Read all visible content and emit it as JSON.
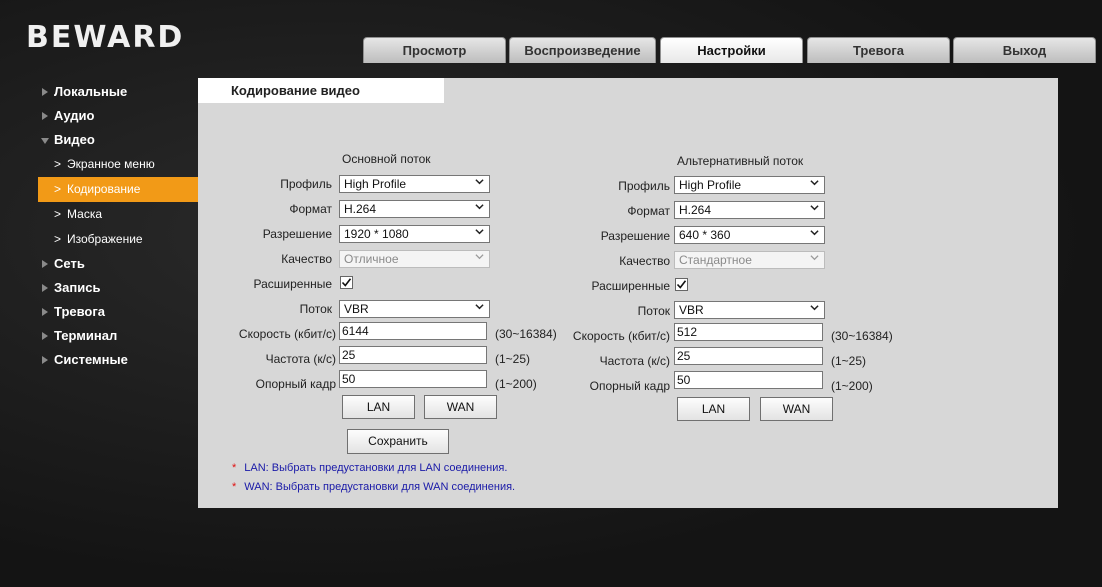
{
  "brand": {
    "logo_text": "BEWARD"
  },
  "tabs": [
    {
      "label": "Просмотр"
    },
    {
      "label": "Воспроизведение"
    },
    {
      "label": "Настройки"
    },
    {
      "label": "Тревога"
    },
    {
      "label": "Выход"
    }
  ],
  "sidebar": {
    "items": [
      {
        "label": "Локальные"
      },
      {
        "label": "Аудио"
      },
      {
        "label": "Видео"
      },
      {
        "label": "Сеть"
      },
      {
        "label": "Запись"
      },
      {
        "label": "Тревога"
      },
      {
        "label": "Терминал"
      },
      {
        "label": "Системные"
      }
    ],
    "video_sub": [
      {
        "label": "Экранное меню"
      },
      {
        "label": "Кодирование"
      },
      {
        "label": "Маска"
      },
      {
        "label": "Изображение"
      }
    ]
  },
  "content": {
    "tab_title": "Кодирование видео",
    "labels": {
      "profile": "Профиль",
      "format": "Формат",
      "resolution": "Разрешение",
      "quality": "Качество",
      "advanced": "Расширенные",
      "stream": "Поток",
      "bitrate": "Скорость (кбит/с)",
      "framerate": "Частота (к/с)",
      "keyframe": "Опорный кадр"
    },
    "main": {
      "title": "Основной поток",
      "profile": "High Profile",
      "format": "H.264",
      "resolution": "1920 * 1080",
      "quality": "Отличное",
      "advanced": true,
      "stream": "VBR",
      "bitrate": "6144",
      "bitrate_range": "(30~16384)",
      "framerate": "25",
      "framerate_range": "(1~25)",
      "keyframe": "50",
      "keyframe_range": "(1~200)",
      "lan": "LAN",
      "wan": "WAN"
    },
    "alt": {
      "title": "Альтернативный поток",
      "profile": "High Profile",
      "format": "H.264",
      "resolution": "640 * 360",
      "quality": "Стандартное",
      "advanced": true,
      "stream": "VBR",
      "bitrate": "512",
      "bitrate_range": "(30~16384)",
      "framerate": "25",
      "framerate_range": "(1~25)",
      "keyframe": "50",
      "keyframe_range": "(1~200)",
      "lan": "LAN",
      "wan": "WAN"
    },
    "save_label": "Сохранить",
    "notes": {
      "star": "*",
      "lan": "LAN: Выбрать предустановки для LAN соединения.",
      "wan": "WAN: Выбрать предустановки для WAN соединения."
    }
  },
  "colors": {
    "accent": "#f29a17",
    "note_text": "#1a1aa8",
    "star": "#e01010",
    "panel": "#d7d7d7"
  }
}
